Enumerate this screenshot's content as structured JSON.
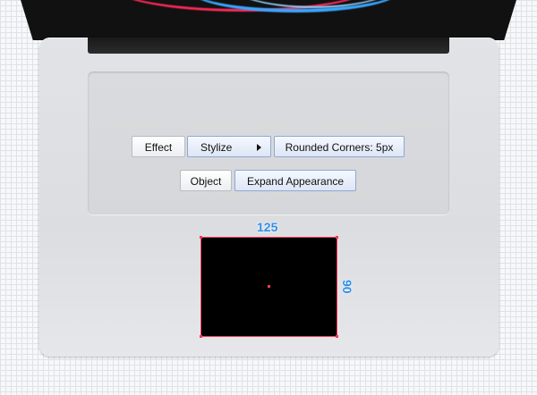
{
  "menu": {
    "row1": {
      "effect_label": "Effect",
      "stylize_label": "Stylize",
      "rounded_corners_label": "Rounded Corners: 5px"
    },
    "row2": {
      "object_label": "Object",
      "expand_appearance_label": "Expand Appearance"
    }
  },
  "dimensions": {
    "width_label": "125",
    "height_label": "90"
  },
  "colors": {
    "accent_blue": "#2f8ee8",
    "selection_red": "#f23a5a",
    "trackpad_fill": "#000000"
  }
}
